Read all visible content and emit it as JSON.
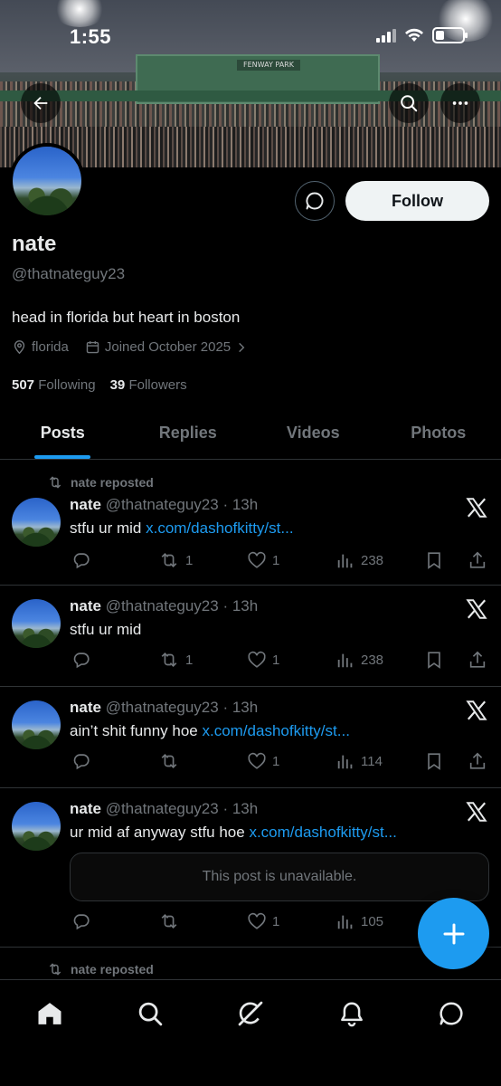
{
  "status_bar": {
    "time": "1:55"
  },
  "banner": {
    "sign_text": "FENWAY PARK"
  },
  "profile": {
    "name": "nate",
    "handle": "@thatnateguy23",
    "bio": "head in florida but heart in boston",
    "location": "florida",
    "joined": "Joined October 2025",
    "following_count": "507",
    "following_label": "Following",
    "followers_count": "39",
    "followers_label": "Followers",
    "follow_button": "Follow"
  },
  "tabs": [
    {
      "label": "Posts",
      "active": true
    },
    {
      "label": "Replies"
    },
    {
      "label": "Videos"
    },
    {
      "label": "Photos"
    }
  ],
  "posts": [
    {
      "repost_label": "nate reposted",
      "name": "nate",
      "meta": "@thatnateguy23 · 13h",
      "text": "stfu ur mid ",
      "link": "x.com/dashofkitty/st...",
      "reposts": "1",
      "likes": "1",
      "views": "238"
    },
    {
      "name": "nate",
      "meta": "@thatnateguy23 · 13h",
      "text": "stfu ur mid",
      "link": "",
      "reposts": "1",
      "likes": "1",
      "views": "238"
    },
    {
      "name": "nate",
      "meta": "@thatnateguy23 · 13h",
      "text": "ain’t shit funny hoe ",
      "link": "x.com/dashofkitty/st...",
      "reposts": "",
      "likes": "1",
      "views": "114"
    },
    {
      "name": "nate",
      "meta": "@thatnateguy23 · 13h",
      "text": "ur mid af anyway stfu hoe ",
      "link": "x.com/dashofkitty/st...",
      "unavailable": "This post is unavailable.",
      "reposts": "",
      "likes": "1",
      "views": "105"
    }
  ],
  "next_repost_label": "nate reposted",
  "colors": {
    "accent": "#1d9bf0",
    "muted": "#71767b",
    "text": "#e7e9ea",
    "border": "#2f3336"
  },
  "icons": {
    "nav": [
      "home-icon",
      "search-icon",
      "grok-icon",
      "notifications-icon",
      "messages-icon"
    ],
    "post_actions": [
      "reply-icon",
      "repost-icon",
      "like-icon",
      "views-icon",
      "bookmark-icon",
      "share-icon"
    ]
  }
}
